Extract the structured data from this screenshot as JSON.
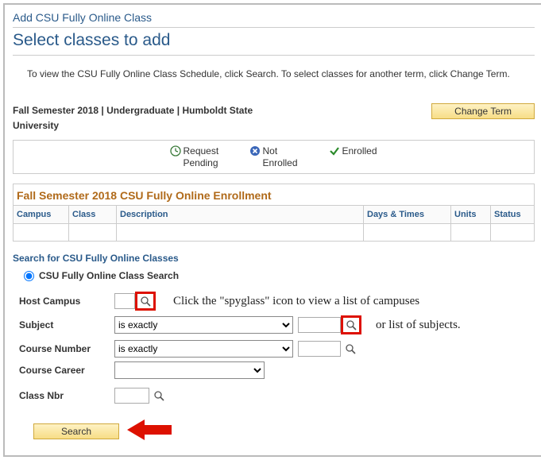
{
  "header": {
    "page_title": "Add CSU Fully Online Class",
    "subtitle": "Select classes to add",
    "intro": "To view the CSU Fully Online Class Schedule, click Search. To select classes for another term, click Change Term."
  },
  "term": {
    "line": "Fall Semester 2018 | Undergraduate | Humboldt State University",
    "change_term_btn": "Change Term"
  },
  "legend": {
    "request_pending": "Request Pending",
    "not_enrolled": "Not Enrolled",
    "enrolled": "Enrolled"
  },
  "enrollment": {
    "title": "Fall Semester 2018 CSU Fully Online Enrollment",
    "cols": {
      "campus": "Campus",
      "class": "Class",
      "description": "Description",
      "days_times": "Days & Times",
      "units": "Units",
      "status": "Status"
    }
  },
  "search": {
    "heading": "Search for CSU Fully Online Classes",
    "radio_label": "CSU Fully Online Class Search",
    "fields": {
      "host_campus": "Host Campus",
      "subject": "Subject",
      "course_number": "Course Number",
      "course_career": "Course Career",
      "class_nbr": "Class Nbr"
    },
    "op_is_exactly": "is exactly",
    "search_btn": "Search"
  },
  "annotation": {
    "line1": "Click the \"spyglass\" icon to view a list of campuses",
    "line2": "or list of subjects."
  }
}
